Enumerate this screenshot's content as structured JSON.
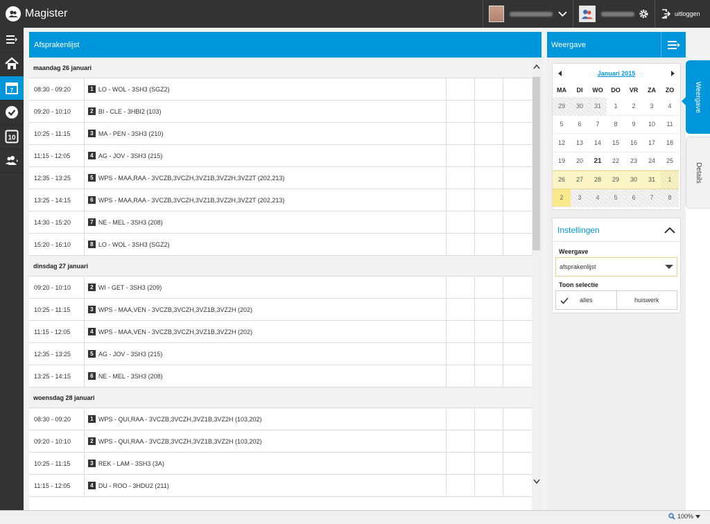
{
  "app": {
    "title": "Magister",
    "logout_label": "uitloggen"
  },
  "main": {
    "title": "Afsprakenlijst",
    "days": [
      {
        "label": "maandag 26 januari",
        "items": [
          {
            "time": "08:30 - 09:20",
            "hour": "1",
            "desc": "LO - WOL - 3SH3 (SGZ2)"
          },
          {
            "time": "09:20 - 10:10",
            "hour": "2",
            "desc": "BI - CLE - 3HBI2 (103)"
          },
          {
            "time": "10:25 - 11:15",
            "hour": "3",
            "desc": "MA - PEN - 3SH3 (210)"
          },
          {
            "time": "11:15 - 12:05",
            "hour": "4",
            "desc": "AG - JOV - 3SH3 (215)"
          },
          {
            "time": "12:35 - 13:25",
            "hour": "5",
            "desc": "WPS - MAA,RAA - 3VCZB,3VCZH,3VZ1B,3VZ2H,3VZ2T (202,213)"
          },
          {
            "time": "13:25 - 14:15",
            "hour": "6",
            "desc": "WPS - MAA,RAA - 3VCZB,3VCZH,3VZ1B,3VZ2H,3VZ2T (202,213)"
          },
          {
            "time": "14:30 - 15:20",
            "hour": "7",
            "desc": "NE - MEL - 3SH3 (208)"
          },
          {
            "time": "15:20 - 16:10",
            "hour": "8",
            "desc": "LO - WOL - 3SH3 (SGZ2)"
          }
        ]
      },
      {
        "label": "dinsdag 27 januari",
        "items": [
          {
            "time": "09:20 - 10:10",
            "hour": "2",
            "desc": "WI - GET - 3SH3 (209)"
          },
          {
            "time": "10:25 - 11:15",
            "hour": "3",
            "desc": "WPS - MAA,VEN - 3VCZB,3VCZH,3VZ1B,3VZ2H (202)"
          },
          {
            "time": "11:15 - 12:05",
            "hour": "4",
            "desc": "WPS - MAA,VEN - 3VCZB,3VCZH,3VZ1B,3VZ2H (202)"
          },
          {
            "time": "12:35 - 13:25",
            "hour": "5",
            "desc": "AG - JOV - 3SH3 (215)"
          },
          {
            "time": "13:25 - 14:15",
            "hour": "6",
            "desc": "NE - MEL - 3SH3 (208)"
          }
        ]
      },
      {
        "label": "woensdag 28 januari",
        "items": [
          {
            "time": "08:30 - 09:20",
            "hour": "1",
            "desc": "WPS - QUI,RAA - 3VCZB,3VCZH,3VZ1B,3VZ2H (103,202)"
          },
          {
            "time": "09:20 - 10:10",
            "hour": "2",
            "desc": "WPS - QUI,RAA - 3VCZB,3VCZH,3VZ1B,3VZ2H (103,202)"
          },
          {
            "time": "10:25 - 11:15",
            "hour": "3",
            "desc": "REK - LAM - 3SH3 (3A)"
          },
          {
            "time": "11:15 - 12:05",
            "hour": "4",
            "desc": "DU - ROO - 3HDU2 (211)"
          }
        ]
      }
    ]
  },
  "sidebar": {
    "title": "Weergave",
    "calendar": {
      "month": "Januari 2015",
      "dows": [
        "MA",
        "DI",
        "WO",
        "DO",
        "VR",
        "ZA",
        "ZO"
      ],
      "days": [
        [
          "29",
          "30",
          "31",
          "1",
          "2",
          "3",
          "4"
        ],
        [
          "5",
          "6",
          "7",
          "8",
          "9",
          "10",
          "11"
        ],
        [
          "12",
          "13",
          "14",
          "15",
          "16",
          "17",
          "18"
        ],
        [
          "19",
          "20",
          "21",
          "22",
          "23",
          "24",
          "25"
        ],
        [
          "26",
          "27",
          "28",
          "29",
          "30",
          "31",
          "1"
        ],
        [
          "2",
          "3",
          "4",
          "5",
          "6",
          "7",
          "8"
        ]
      ],
      "today": "21"
    },
    "settings": {
      "title": "Instellingen",
      "weergave_label": "Weergave",
      "weergave_value": "afsprakenlijst",
      "selectie_label": "Toon selectie",
      "option_all": "alles",
      "option_homework": "huiswerk"
    }
  },
  "tabs": {
    "weergave": "Weergave",
    "details": "Details"
  },
  "status": {
    "zoom": "100%"
  }
}
